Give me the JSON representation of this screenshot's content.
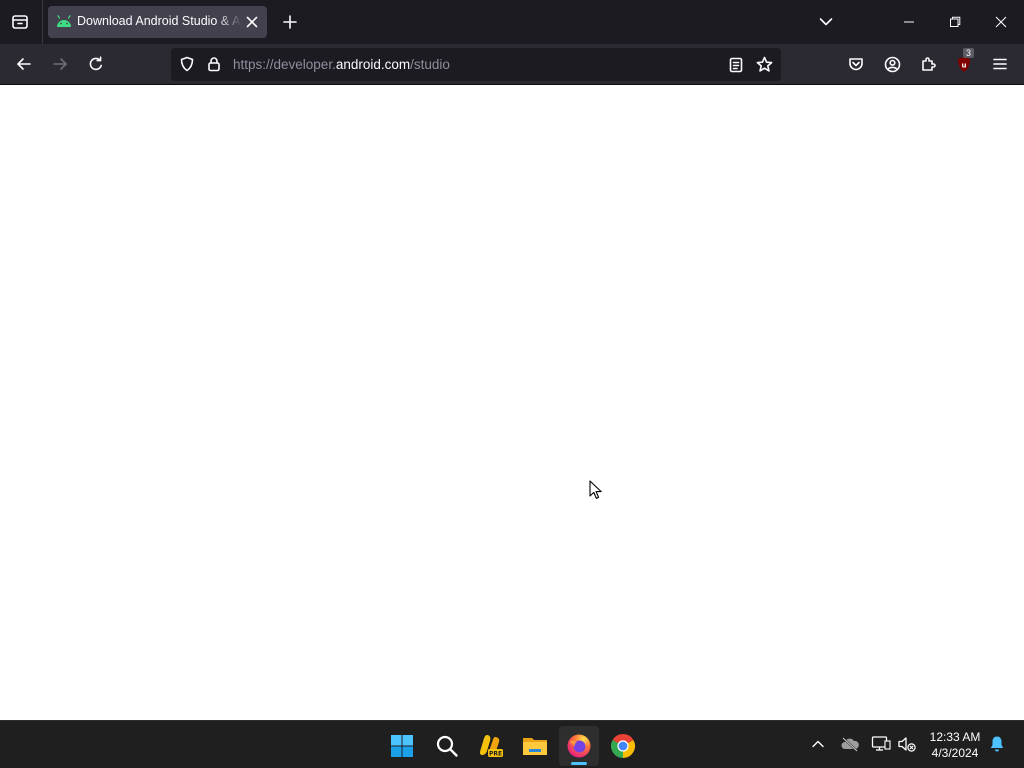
{
  "browser": {
    "tab": {
      "title": "Download Android Studio & App Tools",
      "favicon": "android-icon",
      "favicon_color": "#3ddc84"
    },
    "url": {
      "prefix": "https://developer.",
      "host": "android.com",
      "path": "/studio"
    },
    "extensions": {
      "ublock_badge": "3"
    },
    "colors": {
      "tabbar_bg": "#1c1b22",
      "toolbar_bg": "#2b2a33",
      "urlbar_bg": "#1c1b22",
      "active_tab_bg": "#42414d"
    }
  },
  "taskbar": {
    "apps": [
      {
        "name": "Start",
        "icon": "windows-start-icon"
      },
      {
        "name": "Search",
        "icon": "search-icon"
      },
      {
        "name": "Copilot PRE",
        "icon": "copilot-pre-icon"
      },
      {
        "name": "File Explorer",
        "icon": "file-explorer-icon"
      },
      {
        "name": "Firefox",
        "icon": "firefox-icon",
        "active": true
      },
      {
        "name": "Chrome",
        "icon": "chrome-icon"
      }
    ],
    "clock": {
      "time": "12:33 AM",
      "date": "4/3/2024"
    }
  }
}
